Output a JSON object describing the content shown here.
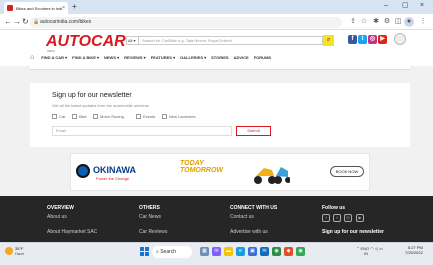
{
  "browser": {
    "tab_title": "Bikes and Scooters in India - Pric",
    "tab_close": "×",
    "new_tab": "+",
    "url": "autocarindia.com/bikes",
    "win_minimize": "–",
    "win_maximize": "▢",
    "win_close": "×"
  },
  "site": {
    "logo": "AUTOCAR",
    "logo_sub": "INDIA",
    "search_select": "All ▾",
    "search_placeholder": "Search for Car/Bike e.g. Tata Nexon, Royal Enfield",
    "nav": [
      "FIND A CAR ▾",
      "FIND A BIKE ▾",
      "NEWS ▾",
      "REVIEWS ▾",
      "FEATURES ▾",
      "GALLERIES ▾",
      "STORIES",
      "ADVICE",
      "FORUMS"
    ]
  },
  "newsletter": {
    "title": "Sign up for our newsletter",
    "subtitle": "Get all the latest updates from the automobile universe",
    "options": [
      "Car",
      "Bike",
      "Motor Racing",
      "Events",
      "New Launches"
    ],
    "email_placeholder": "Email",
    "submit": "Submit"
  },
  "ad": {
    "brand": "OKINAWA",
    "tagline": "Power the Change",
    "headline_1": "TODAY",
    "headline_2": "TOMORROW",
    "button": "BOOK NOW"
  },
  "footer": {
    "cols": [
      {
        "title": "OVERVIEW",
        "link1": "About us",
        "link2": "About Haymarket SAC"
      },
      {
        "title": "OTHERS",
        "link1": "Car News",
        "link2": "Car Reviews"
      },
      {
        "title": "CONNECT WITH US",
        "link1": "Contact us",
        "link2": "Advertise with us"
      },
      {
        "title": "Follow us",
        "link2": "Sign up for our newsletter"
      }
    ]
  },
  "taskbar": {
    "weather_temp": "35°F",
    "weather_desc": "Haze",
    "search": "Search",
    "lang_1": "ENG",
    "lang_2": "IN",
    "time": "5:27 PM",
    "date": "7/25/2022"
  }
}
